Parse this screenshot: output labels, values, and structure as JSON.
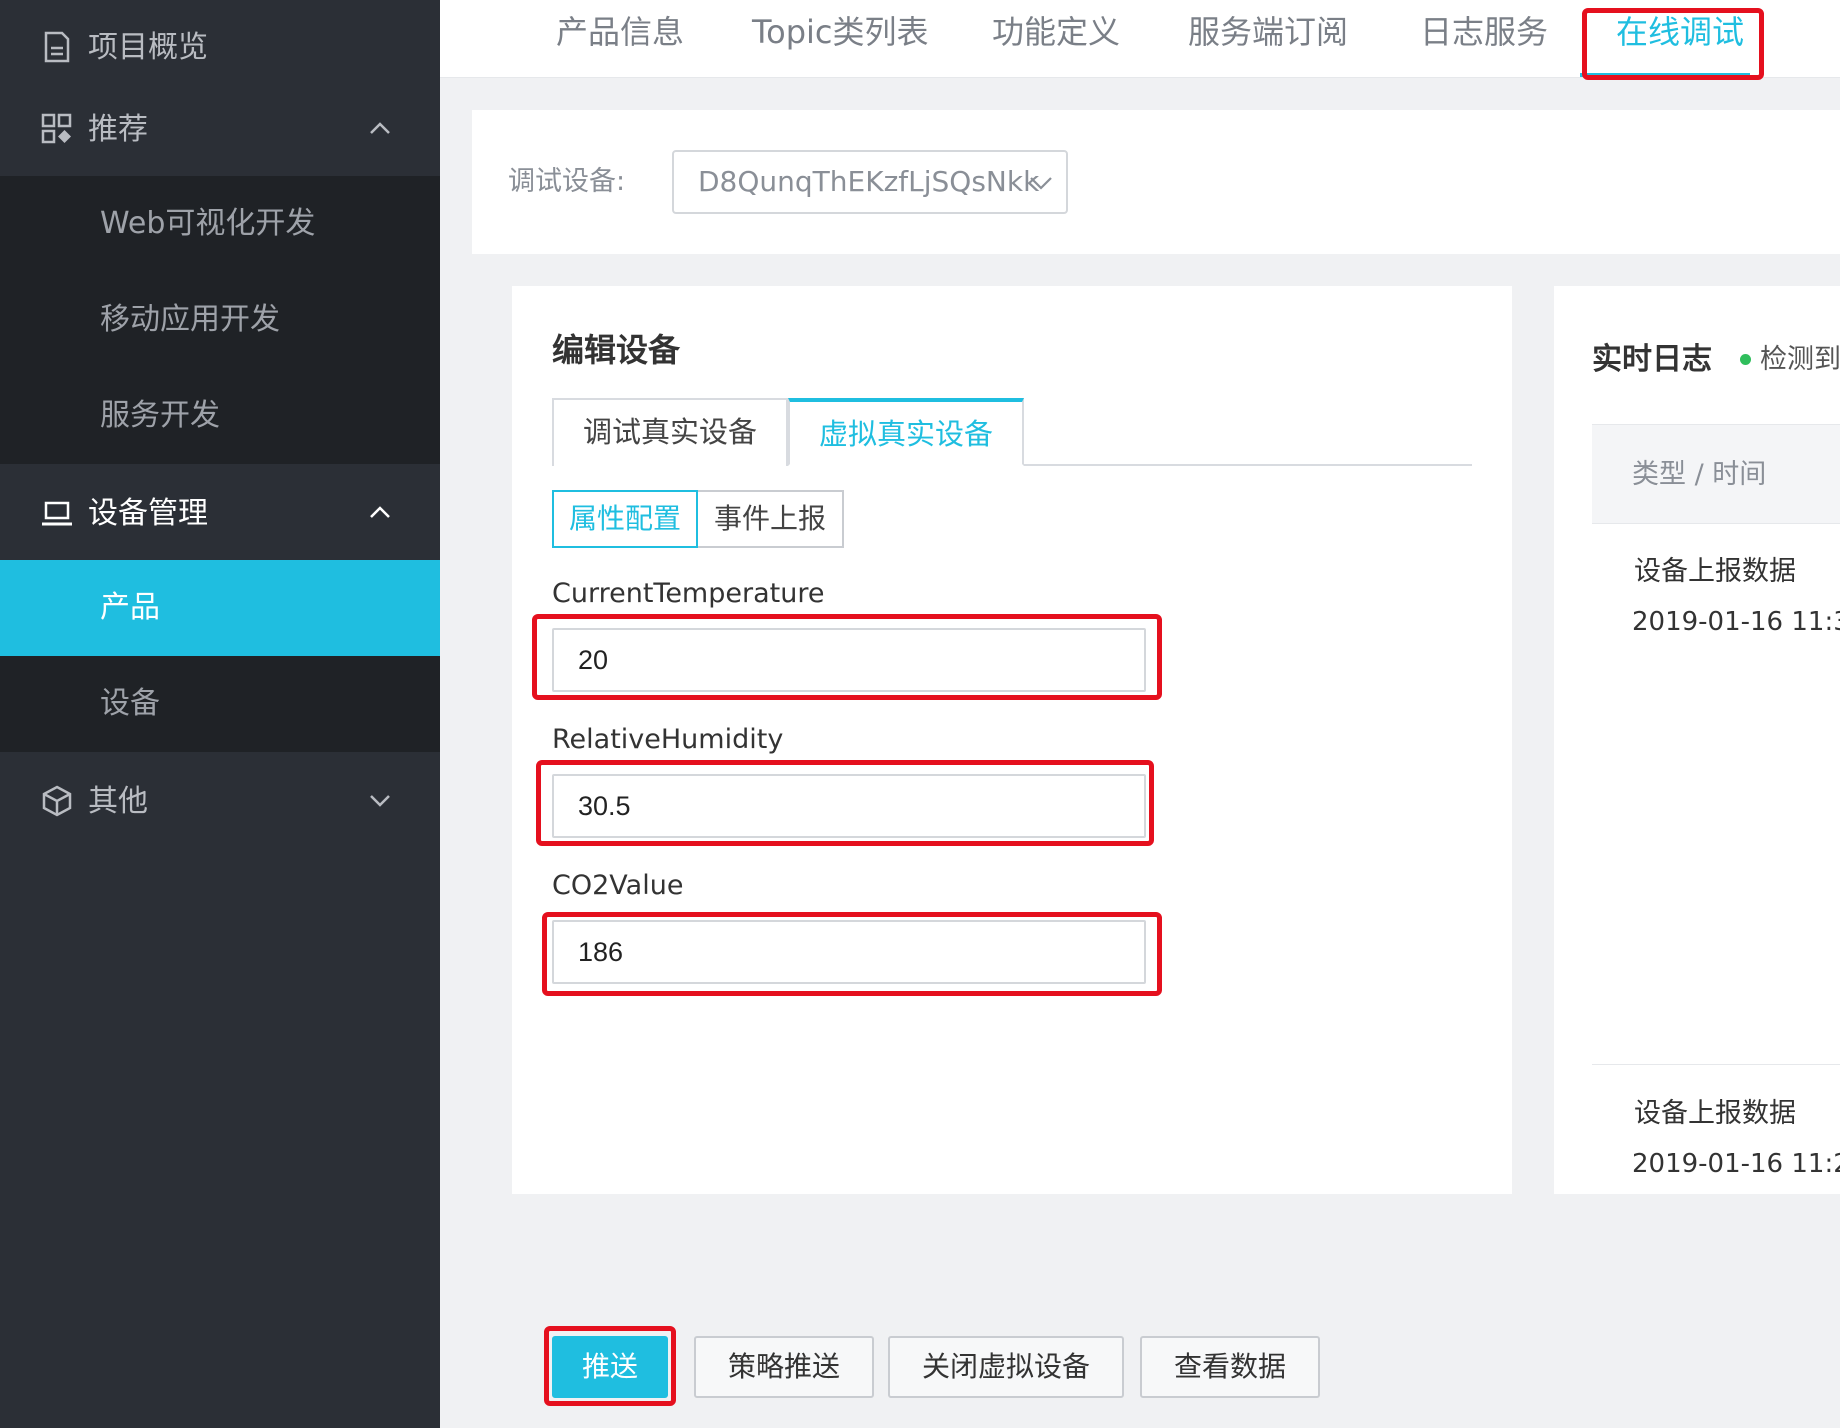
{
  "sidebar": {
    "items": [
      {
        "label": "项目概览",
        "icon": "document-icon"
      },
      {
        "label": "推荐",
        "icon": "grid-icon"
      },
      {
        "label": "设备管理",
        "icon": "laptop-icon"
      },
      {
        "label": "其他",
        "icon": "cube-icon"
      }
    ],
    "recommend_sub": [
      "Web可视化开发",
      "移动应用开发",
      "服务开发"
    ],
    "device_sub": [
      "产品",
      "设备"
    ]
  },
  "tabs": [
    "产品信息",
    "Topic类列表",
    "功能定义",
    "服务端订阅",
    "日志服务",
    "在线调试"
  ],
  "debug": {
    "device_label": "调试设备:",
    "device_value": "D8QunqThEKzfLjSQsNkk"
  },
  "edit": {
    "title": "编辑设备",
    "mode_tabs": [
      "调试真实设备",
      "虚拟真实设备"
    ],
    "segments": [
      "属性配置",
      "事件上报"
    ],
    "fields": [
      {
        "label": "CurrentTemperature",
        "value": "20"
      },
      {
        "label": "RelativeHumidity",
        "value": "30.5"
      },
      {
        "label": "CO2Value",
        "value": "186"
      }
    ]
  },
  "log": {
    "title": "实时日志",
    "status": "检测到",
    "column": "类型 / 时间",
    "entries": [
      {
        "type": "设备上报数据",
        "time": "2019-01-16 11:3"
      },
      {
        "type": "设备上报数据",
        "time": "2019-01-16 11:2"
      }
    ]
  },
  "actions": [
    "推送",
    "策略推送",
    "关闭虚拟设备",
    "查看数据"
  ],
  "colors": {
    "accent": "#1fbee0",
    "highlight": "#e5101e",
    "sidebar": "#2b2f36"
  }
}
